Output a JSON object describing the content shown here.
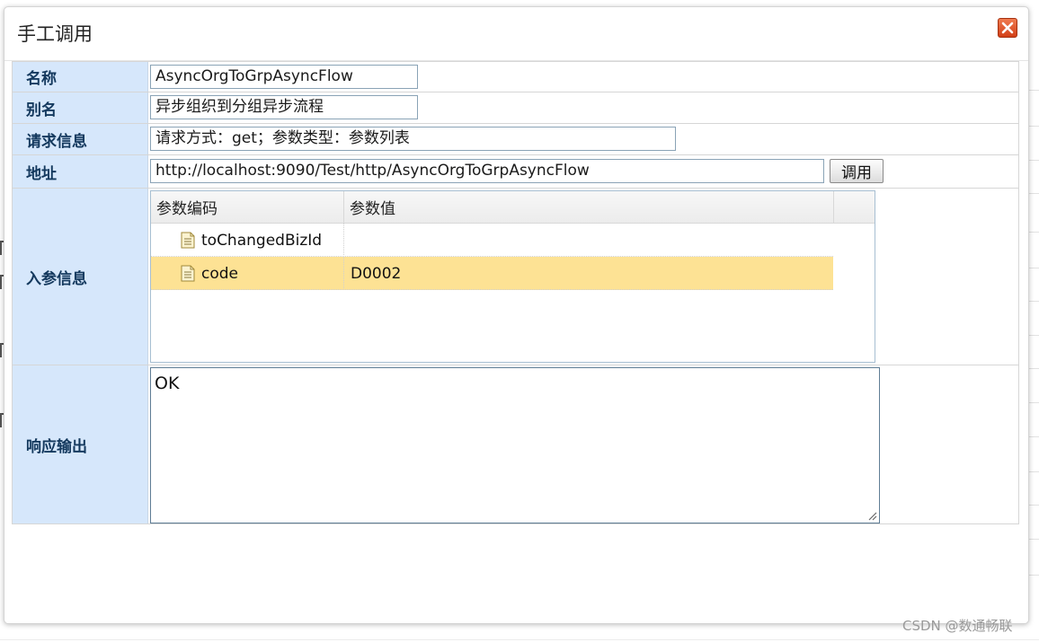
{
  "dialog": {
    "title": "手工调用",
    "close_icon": "close-icon"
  },
  "form": {
    "name": {
      "label": "名称",
      "value": "AsyncOrgToGrpAsyncFlow"
    },
    "alias": {
      "label": "别名",
      "value": "异步组织到分组异步流程"
    },
    "request_info": {
      "label": "请求信息",
      "value": "请求方式：get；参数类型：参数列表"
    },
    "address": {
      "label": "地址",
      "value": "http://localhost:9090/Test/http/AsyncOrgToGrpAsyncFlow",
      "call_label": "调用"
    },
    "params": {
      "label": "入参信息",
      "columns": [
        "参数编码",
        "参数值"
      ],
      "rows": [
        {
          "code": "toChangedBizId",
          "value": "",
          "selected": false
        },
        {
          "code": "code",
          "value": "D0002",
          "selected": true
        }
      ]
    },
    "response": {
      "label": "响应输出",
      "value": "OK"
    }
  },
  "colors": {
    "label_bg": "#d6e7fb",
    "label_text": "#14395e",
    "selected_row": "#fde294",
    "close_red": "#d23f17"
  },
  "watermark": "CSDN @数通畅联"
}
